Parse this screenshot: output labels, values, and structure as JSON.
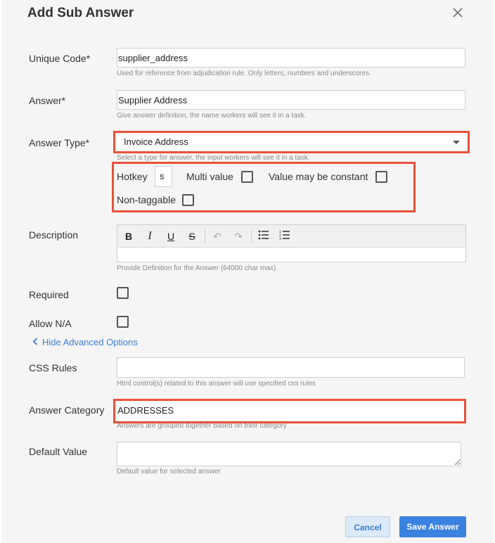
{
  "dialog": {
    "title": "Add Sub Answer"
  },
  "fields": {
    "unique_code": {
      "label": "Unique Code*",
      "value": "supplier_address",
      "help": "Used for reference from adjudication rule. Only letters, numbers and underscores."
    },
    "answer": {
      "label": "Answer*",
      "value": "Supplier Address",
      "help": "Give answer definition, the name workers will see it in a task."
    },
    "answer_type": {
      "label": "Answer Type*",
      "value": "Invoice Address",
      "help": "Select a type for answer, the input workers will see it in a task."
    },
    "options": {
      "hotkey_label": "Hotkey",
      "hotkey_value": "s",
      "multi_value_label": "Multi value",
      "constant_label": "Value may be constant",
      "non_taggable_label": "Non-taggable"
    },
    "description": {
      "label": "Description",
      "help": "Provide Definition for the Answer (64000 char max)."
    },
    "required": {
      "label": "Required"
    },
    "allow_na": {
      "label": "Allow N/A"
    },
    "advanced_link": "Hide Advanced Options",
    "css_rules": {
      "label": "CSS Rules",
      "value": "",
      "help": "Html control(s) related to this answer will use specified css rules"
    },
    "answer_category": {
      "label": "Answer Category",
      "value": "ADDRESSES",
      "help": "Answers are grouped together based on their category"
    },
    "default_value": {
      "label": "Default Value",
      "value": "",
      "help": "Default value for selected answer"
    }
  },
  "toolbar": {
    "bold": "B",
    "italic": "I",
    "underline": "U",
    "strike": "S",
    "undo": "↶",
    "redo": "↷"
  },
  "buttons": {
    "cancel": "Cancel",
    "save": "Save Answer"
  },
  "colors": {
    "highlight": "#e8513a",
    "primary": "#3b82e0",
    "link": "#3b7fd1"
  }
}
